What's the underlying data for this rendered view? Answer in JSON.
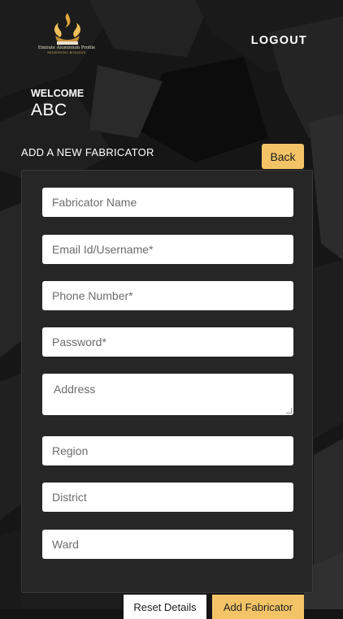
{
  "brand": {
    "name": "Emirate Aluminium Profile",
    "tagline": "REDEFINING BUILDING",
    "logo_icon": "flame-crest-icon"
  },
  "header": {
    "logout_label": "LOGOUT"
  },
  "welcome": {
    "label": "WELCOME",
    "name": "ABC"
  },
  "page": {
    "title": "ADD A NEW FABRICATOR",
    "back_label": "Back"
  },
  "form": {
    "fields": [
      {
        "placeholder": "Fabricator Name"
      },
      {
        "placeholder": "Email Id/Username*"
      },
      {
        "placeholder": "Phone Number*"
      },
      {
        "placeholder": "Password*"
      },
      {
        "placeholder": "Address"
      },
      {
        "placeholder": "Region"
      },
      {
        "placeholder": "District"
      },
      {
        "placeholder": "Ward"
      }
    ],
    "reset_label": "Reset Details",
    "submit_label": "Add Fabricator"
  },
  "colors": {
    "accent": "#f3c467",
    "background": "#141414",
    "card": "#262626"
  }
}
